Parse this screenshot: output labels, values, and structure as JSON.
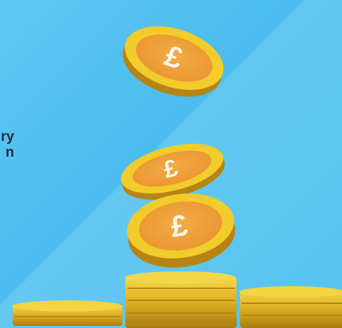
{
  "colors": {
    "sky": "#55c2f1",
    "coin_gold": "#f2cc2a",
    "coin_orange": "#f0a13b",
    "coin_shadow": "#b8870f",
    "symbol_white": "#f7f5ea",
    "text_dark": "#222d3a"
  },
  "icons": {
    "coin": "pound-coin-icon"
  },
  "coin_symbol": "£",
  "partial_text": {
    "line_1": "ry",
    "line_2": "n"
  }
}
